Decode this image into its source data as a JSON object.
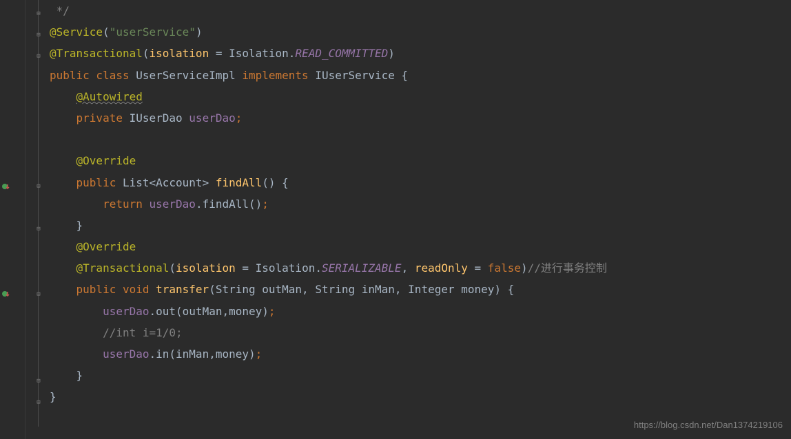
{
  "code": {
    "line1_comment": " */",
    "line2_anno": "@Service",
    "line2_str": "\"userService\"",
    "line3_anno": "@Transactional",
    "line3_param": "isolation",
    "line3_iso": " = Isolation.",
    "line3_const": "READ_COMMITTED",
    "line4_k1": "public class ",
    "line4_cls": "UserServiceImpl ",
    "line4_k2": "implements ",
    "line4_iface": "IUserService {",
    "line5_anno": "@Autowired",
    "line6_k": "private ",
    "line6_type": "IUserDao ",
    "line6_field": "userDao",
    "line7_empty": "",
    "line8_anno": "@Override",
    "line9_k": "public ",
    "line9_type": "List<Account> ",
    "line9_method": "findAll",
    "line9_rest": "() {",
    "line10_k": "return ",
    "line10_field": "userDao",
    "line10_dot": ".findAll()",
    "line11_brace": "}",
    "line12_anno": "@Override",
    "line13_anno": "@Transactional",
    "line13_p1": "isolation",
    "line13_iso": " = Isolation.",
    "line13_const": "SERIALIZABLE",
    "line13_comma": ", ",
    "line13_p2": "readOnly",
    "line13_eq": " = ",
    "line13_false": "false",
    "line13_comment": "//进行事务控制",
    "line14_k1": "public void ",
    "line14_method": "transfer",
    "line14_sig": "(String outMan, String inMan, Integer money) {",
    "line15_field": "userDao",
    "line15_call": ".out(outMan,money)",
    "line16_comment": "//int i=1/0;",
    "line17_field": "userDao",
    "line17_call": ".in(inMan,money)",
    "line18_brace": "}",
    "line19_brace": "}"
  },
  "watermark": "https://blog.csdn.net/Dan1374219106"
}
